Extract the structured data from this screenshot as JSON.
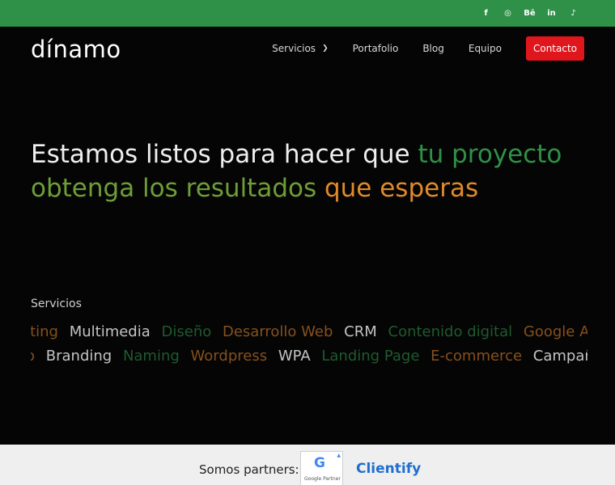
{
  "social": [
    {
      "icon": "facebook-icon",
      "glyph": "f"
    },
    {
      "icon": "instagram-icon",
      "glyph": "◎"
    },
    {
      "icon": "behance-icon",
      "glyph": "Bē"
    },
    {
      "icon": "linkedin-icon",
      "glyph": "in"
    },
    {
      "icon": "tiktok-icon",
      "glyph": "♪"
    }
  ],
  "logo": "dínamo",
  "nav": {
    "servicios": "Servicios",
    "portafolio": "Portafolio",
    "blog": "Blog",
    "equipo": "Equipo",
    "contacto": "Contacto"
  },
  "hero": {
    "part1": "Estamos listos para hacer que ",
    "part2": "tu proyecto",
    "part3": "obtenga los resultados",
    "part4": " que esperas"
  },
  "services_label": "Servicios",
  "services_row1": [
    "eting",
    "Multimedia",
    "Diseño",
    "Desarrollo Web",
    "CRM",
    "Contenido digital",
    "Google ADS"
  ],
  "services_row2": [
    "o",
    "Branding",
    "Naming",
    "Wordpress",
    "WPA",
    "Landing Page",
    "E-commerce",
    "Campañas"
  ],
  "partners": {
    "label": "Somos partners:",
    "google_letter": "G",
    "google_text": "Google Partner",
    "clientify": "Clientify"
  },
  "colors": {
    "topbar": "#2e9147",
    "accent_green": "#2e9147",
    "accent_orange": "#e08a2a",
    "contact_red": "#e0161d"
  }
}
